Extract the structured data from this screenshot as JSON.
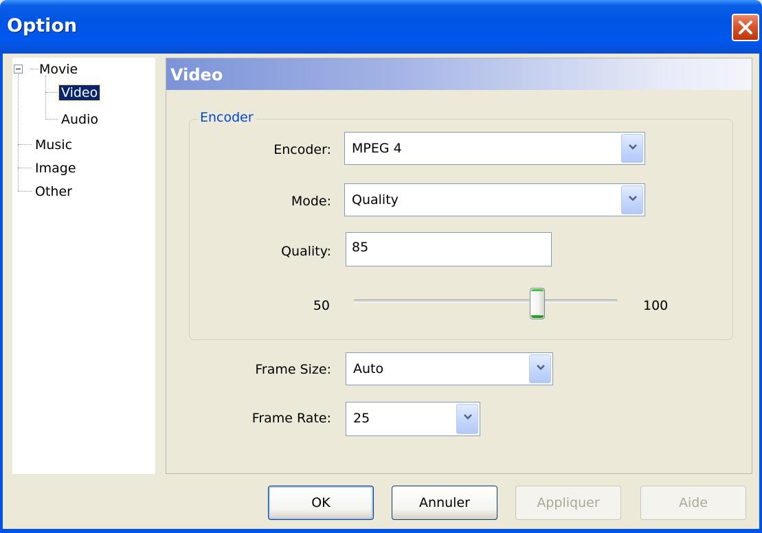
{
  "window": {
    "title": "Option",
    "close_icon": "close-icon"
  },
  "tree": {
    "items": [
      {
        "label": "Movie",
        "expanded": true
      },
      {
        "label": "Video",
        "selected": true
      },
      {
        "label": "Audio"
      },
      {
        "label": "Music"
      },
      {
        "label": "Image"
      },
      {
        "label": "Other"
      }
    ]
  },
  "panel": {
    "title": "Video",
    "group": {
      "legend": "Encoder",
      "encoder_label": "Encoder:",
      "encoder_value": "MPEG 4",
      "mode_label": "Mode:",
      "mode_value": "Quality",
      "quality_label": "Quality:",
      "quality_value": "85",
      "slider_min": "50",
      "slider_max": "100",
      "slider_value": 85
    },
    "frame_size_label": "Frame Size:",
    "frame_size_value": "Auto",
    "frame_rate_label": "Frame Rate:",
    "frame_rate_value": "25"
  },
  "buttons": {
    "ok": "OK",
    "cancel": "Annuler",
    "apply": "Appliquer",
    "help": "Aide"
  },
  "colors": {
    "titlebar": "#0054e3",
    "group_legend": "#0046d5",
    "selection": "#0a246a",
    "dialog_bg": "#ece9d8"
  }
}
